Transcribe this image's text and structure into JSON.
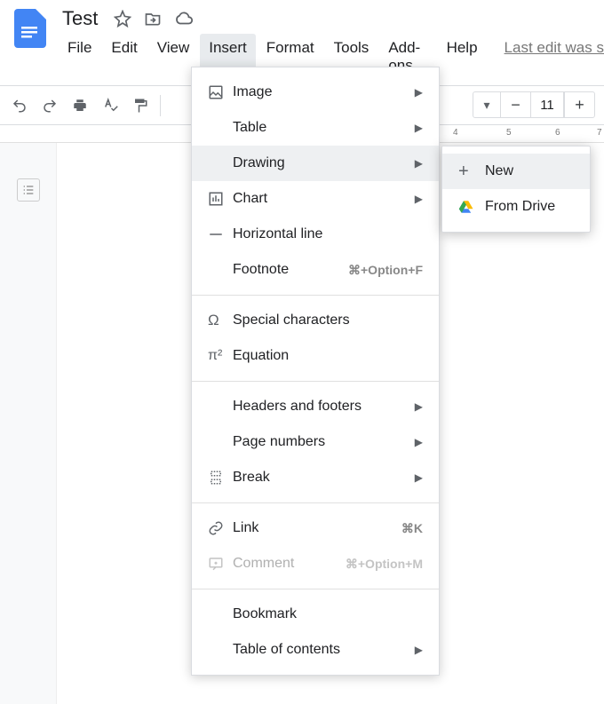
{
  "header": {
    "title": "Test",
    "last_edit": "Last edit was s"
  },
  "menubar": {
    "file": "File",
    "edit": "Edit",
    "view": "View",
    "insert": "Insert",
    "format": "Format",
    "tools": "Tools",
    "addons": "Add-ons",
    "help": "Help"
  },
  "toolbar": {
    "font_size": "11"
  },
  "ruler": {
    "n4": "4",
    "n5": "5",
    "n6": "6",
    "n7": "7"
  },
  "insert_menu": {
    "image": "Image",
    "table": "Table",
    "drawing": "Drawing",
    "chart": "Chart",
    "horizontal_line": "Horizontal line",
    "footnote": "Footnote",
    "footnote_shortcut": "⌘+Option+F",
    "special_chars": "Special characters",
    "equation": "Equation",
    "headers_footers": "Headers and footers",
    "page_numbers": "Page numbers",
    "break": "Break",
    "link": "Link",
    "link_shortcut": "⌘K",
    "comment": "Comment",
    "comment_shortcut": "⌘+Option+M",
    "bookmark": "Bookmark",
    "toc": "Table of contents"
  },
  "drawing_submenu": {
    "new": "New",
    "from_drive": "From Drive"
  }
}
